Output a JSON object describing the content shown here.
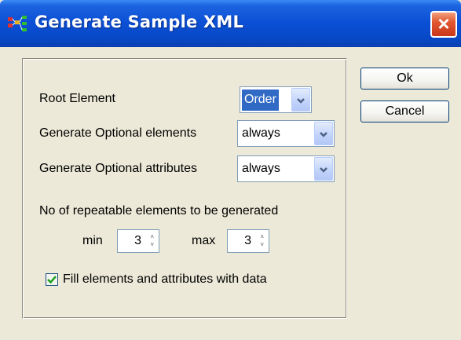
{
  "dialog": {
    "title": "Generate Sample XML",
    "close_label": "×"
  },
  "form": {
    "root_element_label": "Root Element",
    "root_element_value": "Order",
    "optional_elements_label": "Generate Optional elements",
    "optional_elements_value": "always",
    "optional_attributes_label": "Generate Optional attributes",
    "optional_attributes_value": "always",
    "repeatable_label": "No of repeatable elements to be generated",
    "min_label": "min",
    "min_value": "3",
    "max_label": "max",
    "max_value": "3",
    "fill_data_label": "Fill elements and attributes with data",
    "fill_data_checked": true
  },
  "buttons": {
    "ok_label": "Ok",
    "cancel_label": "Cancel"
  },
  "colors": {
    "titlebar": "#0a4fd4",
    "selection": "#316ac5",
    "close": "#e2582f"
  },
  "icons": {
    "title": "xml-schema-icon",
    "dropdown": "chevron-down-icon",
    "checkbox": "checkmark-icon"
  }
}
